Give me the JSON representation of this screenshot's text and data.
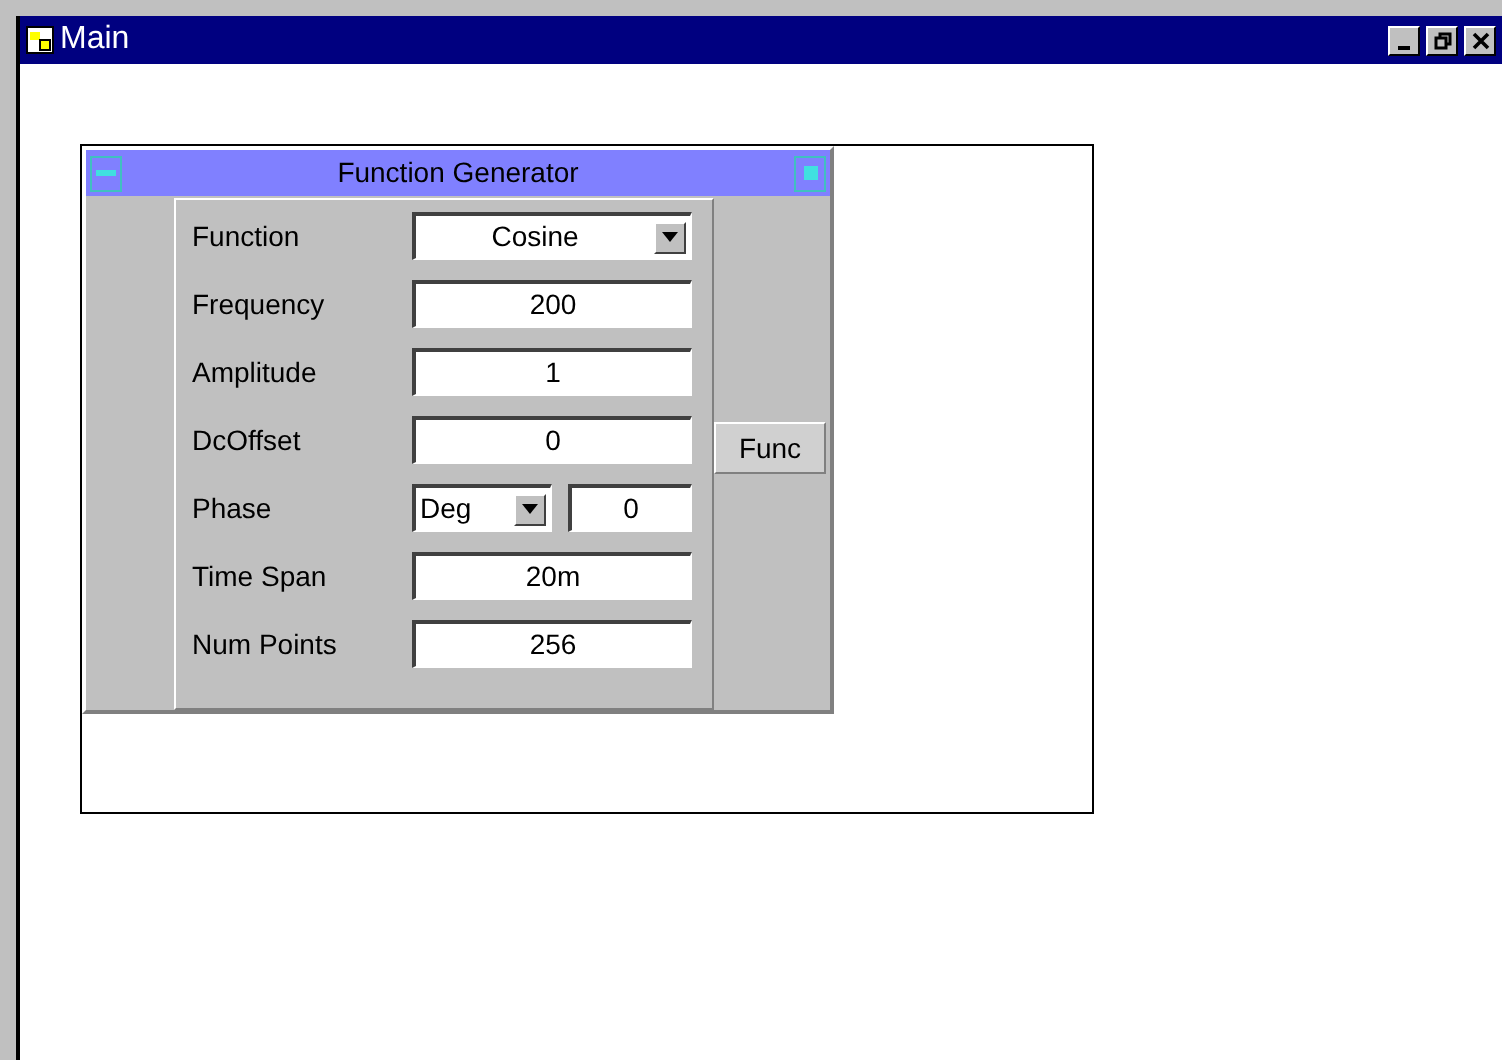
{
  "window": {
    "title": "Main"
  },
  "panel": {
    "title": "Function Generator",
    "output_button": "Func",
    "fields": [
      {
        "label": "Function",
        "kind": "dropdown",
        "value": "Cosine"
      },
      {
        "label": "Frequency",
        "kind": "text",
        "value": "200"
      },
      {
        "label": "Amplitude",
        "kind": "text",
        "value": "1"
      },
      {
        "label": "DcOffset",
        "kind": "text",
        "value": "0"
      },
      {
        "label": "Phase",
        "kind": "unit",
        "unit": "Deg",
        "value": "0"
      },
      {
        "label": "Time Span",
        "kind": "text",
        "value": "20m"
      },
      {
        "label": "Num Points",
        "kind": "text",
        "value": "256"
      }
    ]
  }
}
